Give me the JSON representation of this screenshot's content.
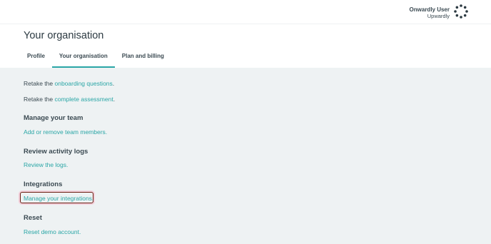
{
  "user": {
    "name": "Onwardly User",
    "organisation": "Upwardly",
    "logo_icon": "dotted-ring-logo-icon"
  },
  "page": {
    "title": "Your organisation"
  },
  "tabs": [
    {
      "label": "Profile",
      "active": false
    },
    {
      "label": "Your organisation",
      "active": true
    },
    {
      "label": "Plan and billing",
      "active": false
    }
  ],
  "sections": {
    "onboarding": {
      "prefix": "Retake the ",
      "link": "onboarding questions",
      "suffix": "."
    },
    "assessment": {
      "prefix": "Retake the ",
      "link": "complete assessment",
      "suffix": "."
    },
    "team": {
      "heading": "Manage your team",
      "link": "Add or remove team members."
    },
    "activity": {
      "heading": "Review activity logs",
      "link": "Review the logs."
    },
    "integrations": {
      "heading": "Integrations",
      "link": "Manage your integrations."
    },
    "reset": {
      "heading": "Reset",
      "link": "Reset demo account."
    }
  },
  "colors": {
    "accent": "#2aa6a6",
    "content_bg": "#eef2f3",
    "highlight_border": "#6b1d10"
  }
}
